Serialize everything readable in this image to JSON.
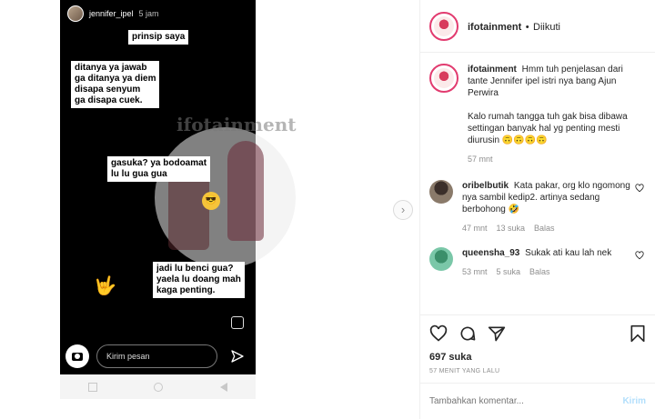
{
  "story": {
    "username": "jennifer_ipel",
    "time": "5 jam",
    "bubbles": [
      "prinsip saya",
      "ditanya ya jawab\nga ditanya ya diem\ndisapa senyum\nga disapa cuek.",
      "gasuka? ya bodoamat\nlu lu gua gua",
      "jadi lu benci gua?\nyaela lu doang mah\nkaga penting."
    ],
    "watermark": "ifotainment",
    "reply_placeholder": "Kirim pesan"
  },
  "header": {
    "account": "ifotainment",
    "separator": "•",
    "follow_status": "Diikuti"
  },
  "caption": {
    "username": "ifotainment",
    "text": "Hmm tuh penjelasan dari tante Jennifer ipel istri nya bang Ajun Perwira\n\nKalo rumah tangga tuh gak bisa dibawa settingan banyak hal yg penting mesti diurusin 🙃🙃🙃🙃",
    "time": "57 mnt"
  },
  "comments": [
    {
      "username": "oribelbutik",
      "text": "Kata pakar, org klo ngomong nya sambil kedip2. artinya sedang berbohong 🤣",
      "time": "47 mnt",
      "likes": "13 suka",
      "reply": "Balas"
    },
    {
      "username": "queensha_93",
      "text": "Sukak ati kau lah nek",
      "time": "53 mnt",
      "likes": "5 suka",
      "reply": "Balas"
    }
  ],
  "actions": {
    "likes": "697 suka",
    "time_ago": "57 MENIT YANG LALU"
  },
  "add_comment": {
    "placeholder": "Tambahkan komentar...",
    "post_label": "Kirim"
  },
  "colors": {
    "accent_disabled": "#b2dffc",
    "muted": "#8e8e8e",
    "brand_ring": "#e23b6f"
  }
}
